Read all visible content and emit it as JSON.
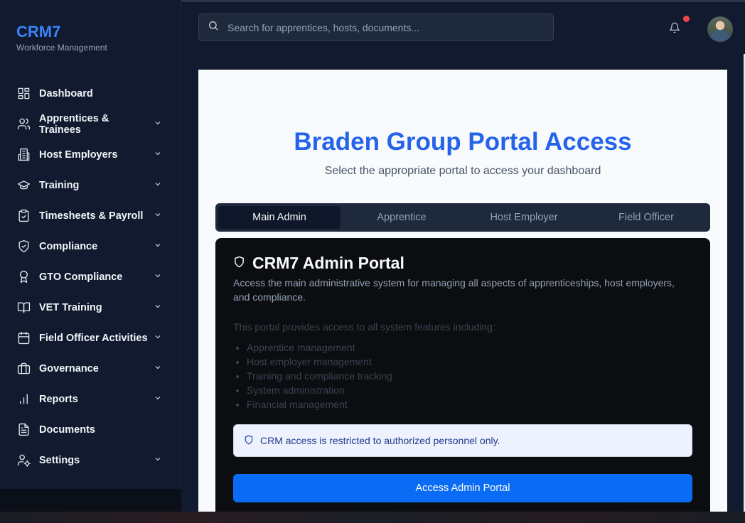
{
  "brand": {
    "title": "CRM7",
    "subtitle": "Workforce Management"
  },
  "sidebar": {
    "items": [
      {
        "label": "Dashboard",
        "icon": "dashboard-icon",
        "has_submenu": false
      },
      {
        "label": "Apprentices & Trainees",
        "icon": "users-icon",
        "has_submenu": true
      },
      {
        "label": "Host Employers",
        "icon": "building-icon",
        "has_submenu": true
      },
      {
        "label": "Training",
        "icon": "graduation-cap-icon",
        "has_submenu": true
      },
      {
        "label": "Timesheets & Payroll",
        "icon": "clipboard-check-icon",
        "has_submenu": true
      },
      {
        "label": "Compliance",
        "icon": "shield-check-icon",
        "has_submenu": true
      },
      {
        "label": "GTO Compliance",
        "icon": "award-icon",
        "has_submenu": true
      },
      {
        "label": "VET Training",
        "icon": "book-open-icon",
        "has_submenu": true
      },
      {
        "label": "Field Officer Activities",
        "icon": "calendar-icon",
        "has_submenu": true
      },
      {
        "label": "Governance",
        "icon": "briefcase-icon",
        "has_submenu": true
      },
      {
        "label": "Reports",
        "icon": "bar-chart-icon",
        "has_submenu": true
      },
      {
        "label": "Documents",
        "icon": "file-text-icon",
        "has_submenu": false
      },
      {
        "label": "Settings",
        "icon": "user-cog-icon",
        "has_submenu": true
      }
    ]
  },
  "search": {
    "placeholder": "Search for apprentices, hosts, documents..."
  },
  "header": {
    "notification_icon": "bell-icon",
    "avatar": "user-avatar"
  },
  "main": {
    "title": "Braden Group Portal Access",
    "subtitle": "Select the appropriate portal to access your dashboard",
    "tabs": [
      {
        "label": "Main Admin",
        "active": true
      },
      {
        "label": "Apprentice",
        "active": false
      },
      {
        "label": "Host Employer",
        "active": false
      },
      {
        "label": "Field Officer",
        "active": false
      }
    ],
    "portal": {
      "title": "CRM7 Admin Portal",
      "description": "Access the main administrative system for managing all aspects of apprenticeships, host employers, and compliance.",
      "intro": "This portal provides access to all system features including:",
      "features": [
        "Apprentice management",
        "Host employer management",
        "Training and compliance tracking",
        "System administration",
        "Financial management"
      ],
      "notice": "CRM access is restricted to authorized personnel only.",
      "button_label": "Access Admin Portal"
    }
  },
  "colors": {
    "accent": "#2563eb",
    "button": "#0a6cf5",
    "sidebar_bg": "#111a2e",
    "notification_dot": "#ef4444"
  }
}
